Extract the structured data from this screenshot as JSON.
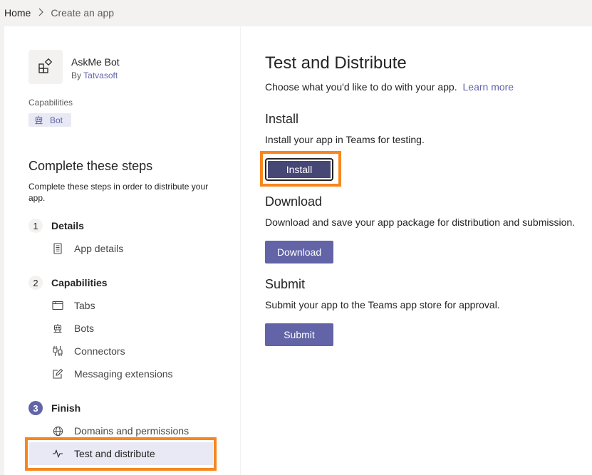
{
  "breadcrumb": {
    "home": "Home",
    "current": "Create an app"
  },
  "app": {
    "name": "AskMe Bot",
    "by_prefix": "By",
    "publisher": "Tatvasoft",
    "icon": "app-grid-icon"
  },
  "capabilities": {
    "label": "Capabilities",
    "badge": "Bot",
    "badge_icon": "bot-icon"
  },
  "steps": {
    "title": "Complete these steps",
    "description": "Complete these steps in order to distribute your app.",
    "groups": [
      {
        "number": "1",
        "label": "Details",
        "items": [
          {
            "label": "App details",
            "icon": "document-icon"
          }
        ]
      },
      {
        "number": "2",
        "label": "Capabilities",
        "items": [
          {
            "label": "Tabs",
            "icon": "tab-icon"
          },
          {
            "label": "Bots",
            "icon": "bot-icon"
          },
          {
            "label": "Connectors",
            "icon": "connector-icon"
          },
          {
            "label": "Messaging extensions",
            "icon": "edit-icon"
          }
        ]
      },
      {
        "number": "3",
        "label": "Finish",
        "items": [
          {
            "label": "Domains and permissions",
            "icon": "globe-icon"
          },
          {
            "label": "Test and distribute",
            "icon": "pulse-icon",
            "selected": true
          }
        ]
      }
    ]
  },
  "main": {
    "title": "Test and Distribute",
    "description": "Choose what you'd like to do with your app.",
    "learn_more": "Learn more",
    "install": {
      "title": "Install",
      "description": "Install your app in Teams for testing.",
      "button": "Install"
    },
    "download": {
      "title": "Download",
      "description": "Download and save your app package for distribution and submission.",
      "button": "Download"
    },
    "submit": {
      "title": "Submit",
      "description": "Submit your app to the Teams app store for approval.",
      "button": "Submit"
    }
  },
  "colors": {
    "accent": "#6264a7",
    "highlight": "#f7861f",
    "selected_bg": "#e8e9f4"
  }
}
